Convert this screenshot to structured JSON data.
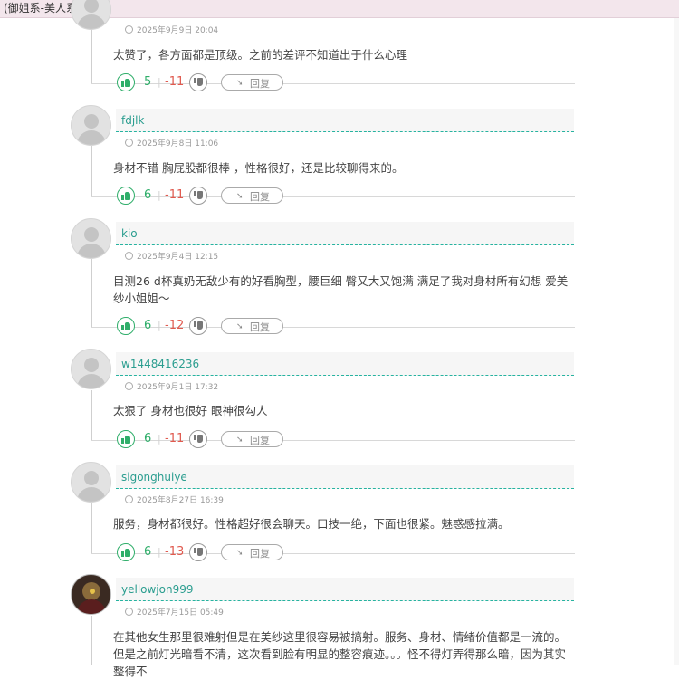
{
  "breadcrumb": {
    "text": "(御姐系-美人系)",
    "separator": "/"
  },
  "actions": {
    "reply_label": "回复",
    "reply_icon": "reply-arrow-icon",
    "pipe": "|"
  },
  "comments": [
    {
      "username": "",
      "date": "2025年9月9日 20:04",
      "content": "太赞了，各方面都是顶级。之前的差评不知道出于什么心理",
      "likes": "5",
      "dislikes": "-11",
      "avatar": "default-avatar"
    },
    {
      "username": "fdjlk",
      "date": "2025年9月8日 11:06",
      "content": "身材不错 胸屁股都很棒 ，性格很好，还是比较聊得来的。",
      "likes": "6",
      "dislikes": "-11",
      "avatar": "default-avatar"
    },
    {
      "username": "kio",
      "date": "2025年9月4日 12:15",
      "content": "目测26 d杯真奶无敌少有的好看胸型，腰巨细 臀又大又饱满 满足了我对身材所有幻想 爱美纱小姐姐～",
      "likes": "6",
      "dislikes": "-12",
      "avatar": "default-avatar"
    },
    {
      "username": "w1448416236",
      "date": "2025年9月1日 17:32",
      "content": "太狠了 身材也很好 眼神很勾人",
      "likes": "6",
      "dislikes": "-11",
      "avatar": "default-avatar"
    },
    {
      "username": "sigonghuiye",
      "date": "2025年8月27日 16:39",
      "content": "服务，身材都很好。性格超好很会聊天。口技一绝，下面也很紧。魅惑感拉满。",
      "likes": "6",
      "dislikes": "-13",
      "avatar": "default-avatar"
    },
    {
      "username": "yellowjon999",
      "date": "2025年7月15日 05:49",
      "content": "在其他女生那里很难射但是在美纱这里很容易被搞射。服务、身材、情绪价值都是一流的。但是之前灯光暗看不清，这次看到脸有明显的整容痕迹。。。怪不得灯弄得那么暗，因为其实整得不",
      "likes": "",
      "dislikes": "",
      "avatar": "custom-avatar"
    }
  ],
  "colors": {
    "accent": "#2a9d8f",
    "like": "#2fae6a",
    "dislike": "#e05a4f",
    "topbar": "#f3e6ec"
  }
}
